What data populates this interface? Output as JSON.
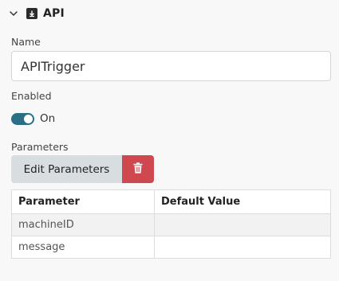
{
  "header": {
    "title": "API",
    "collapse_icon": "chevron-down-icon",
    "type_icon": "arrow-down-box-icon"
  },
  "name_field": {
    "label": "Name",
    "value": "APITrigger"
  },
  "enabled": {
    "label": "Enabled",
    "state_text": "On",
    "is_on": true,
    "color": "#2a6f86"
  },
  "parameters": {
    "label": "Parameters",
    "edit_label": "Edit Parameters",
    "delete_icon": "trash-icon",
    "delete_color": "#d0484f",
    "columns": [
      "Parameter",
      "Default Value"
    ],
    "rows": [
      [
        "machineID",
        ""
      ],
      [
        "message",
        ""
      ]
    ]
  }
}
